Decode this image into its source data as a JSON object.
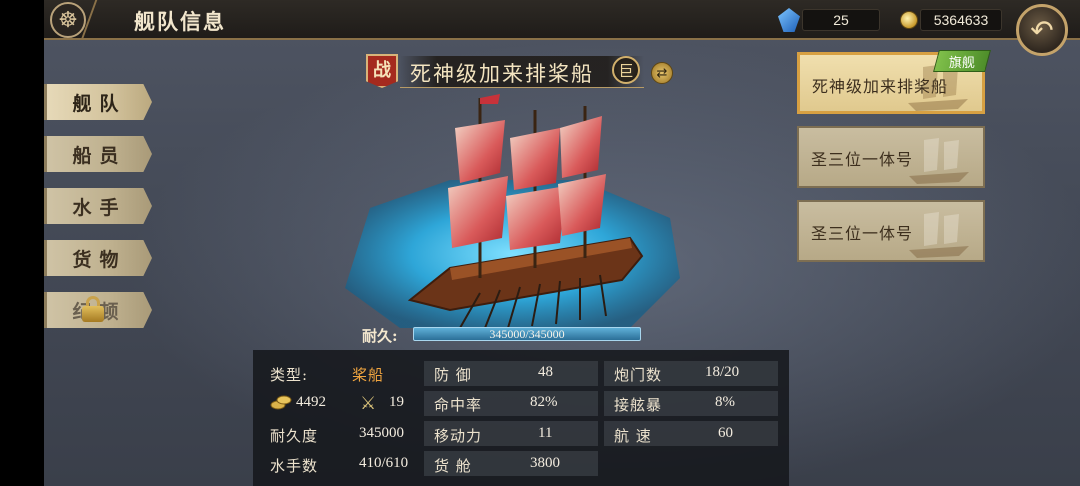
{
  "header": {
    "title": "舰队信息",
    "gems": "25",
    "coins": "5364633"
  },
  "menu": {
    "items": [
      {
        "label": "舰队",
        "active": true
      },
      {
        "label": "船员",
        "active": false
      },
      {
        "label": "水手",
        "active": false
      },
      {
        "label": "货物",
        "active": false
      },
      {
        "label": "纪顿",
        "locked": true
      }
    ]
  },
  "ship": {
    "war_badge": "战",
    "name": "死神级加来排桨船",
    "size_badge": "巨",
    "durability_label": "耐久:",
    "durability_text": "345000/345000",
    "durability_fraction": 1.0
  },
  "stats": {
    "type_label": "类型:",
    "type_value": "桨船",
    "coin_value": "4492",
    "sword_value": "19",
    "durability_label": "耐久度",
    "durability_value": "345000",
    "sailors_label": "水手数",
    "sailors_value": "410/610",
    "defense_label": "防 御",
    "defense_value": "48",
    "accuracy_label": "命中率",
    "accuracy_value": "82%",
    "mobility_label": "移动力",
    "mobility_value": "11",
    "cargo_label": "货 舱",
    "cargo_value": "3800",
    "cannon_label": "炮门数",
    "cannon_value": "18/20",
    "boarding_label": "接舷暴",
    "boarding_value": "8%",
    "speed_label": "航 速",
    "speed_value": "60"
  },
  "fleet": {
    "flag_tag": "旗舰",
    "ships": [
      {
        "name": "死神级加来排桨船",
        "active": true
      },
      {
        "name": "圣三位一体号",
        "active": false
      },
      {
        "name": "圣三位一体号",
        "active": false
      }
    ]
  },
  "colors": {
    "accent_gold": "#d7a042",
    "sail_red": "#c8323a",
    "sea_blue": "#2ea6d8"
  }
}
